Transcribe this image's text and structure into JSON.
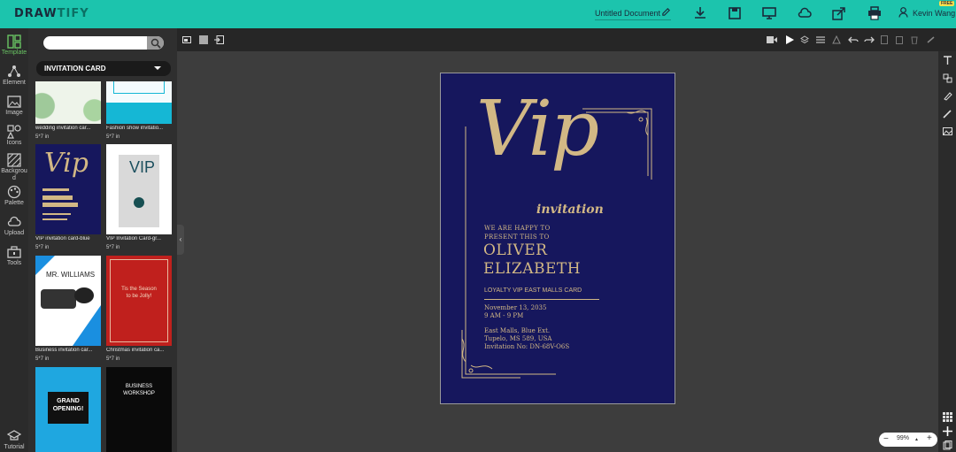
{
  "brand": {
    "logo_a": "DRAW",
    "logo_b": "TIFY"
  },
  "header": {
    "doc_title": "Untitled Document",
    "user_name": "Kevin Wang",
    "plan_badge": "FREE"
  },
  "rail": {
    "items": [
      {
        "label": "Template",
        "icon": "template-icon"
      },
      {
        "label": "Element",
        "icon": "element-icon"
      },
      {
        "label": "Image",
        "icon": "image-icon"
      },
      {
        "label": "Icons",
        "icon": "shapes-icon"
      },
      {
        "label": "Backgrou\nd",
        "icon": "background-icon"
      },
      {
        "label": "Palette",
        "icon": "palette-icon"
      },
      {
        "label": "Upload",
        "icon": "cloud-upload-icon"
      },
      {
        "label": "Tools",
        "icon": "toolbox-icon"
      },
      {
        "label": "Tutorial",
        "icon": "graduation-cap-icon"
      }
    ]
  },
  "panel": {
    "search_placeholder": "",
    "category": "INVITATION CARD",
    "templates": [
      {
        "name": "wedding invitation car...",
        "size": "5*7 in"
      },
      {
        "name": "Fashion show invitatio...",
        "size": "5*7 in"
      },
      {
        "name": "VIP invitation card-blue",
        "size": "5*7 in"
      },
      {
        "name": "VIP Invitation Card-gr...",
        "size": "5*7 in"
      },
      {
        "name": "Business invitation car...",
        "size": "5*7 in"
      },
      {
        "name": "Christmas invitation ca...",
        "size": "5*7 in"
      }
    ],
    "thumb_texts": {
      "vip_small": "Vip",
      "vip_grey": "VIP",
      "mr": "MR. WILLIAMS",
      "xmas": "Tis the Season to be Jolly!",
      "grand": "GRAND OPENING!",
      "workshop": "BUSINESS WORKSHOP"
    }
  },
  "document": {
    "vip": "Vip",
    "invitation": "invitation",
    "line1": "WE ARE HAPPY TO",
    "line2": "PRESENT THIS TO",
    "name1": "OLIVER",
    "name2": "ELIZABETH",
    "loyalty": "LOYALTY VIP EAST MALLS CARD",
    "date": "November 13, 2035",
    "time": "9 AM - 9 PM",
    "loc1": "East Malls, Blue Ext.",
    "loc2": "Tupelo, MS 589, USA",
    "inv": "Invitation No: DN-68V-O6S"
  },
  "zoom": {
    "level": "99%",
    "minus": "−",
    "plus": "+"
  },
  "colors": {
    "brand": "#1cc4ad",
    "card": "#16175d",
    "gold": "#d2b885",
    "active": "#69c463"
  }
}
